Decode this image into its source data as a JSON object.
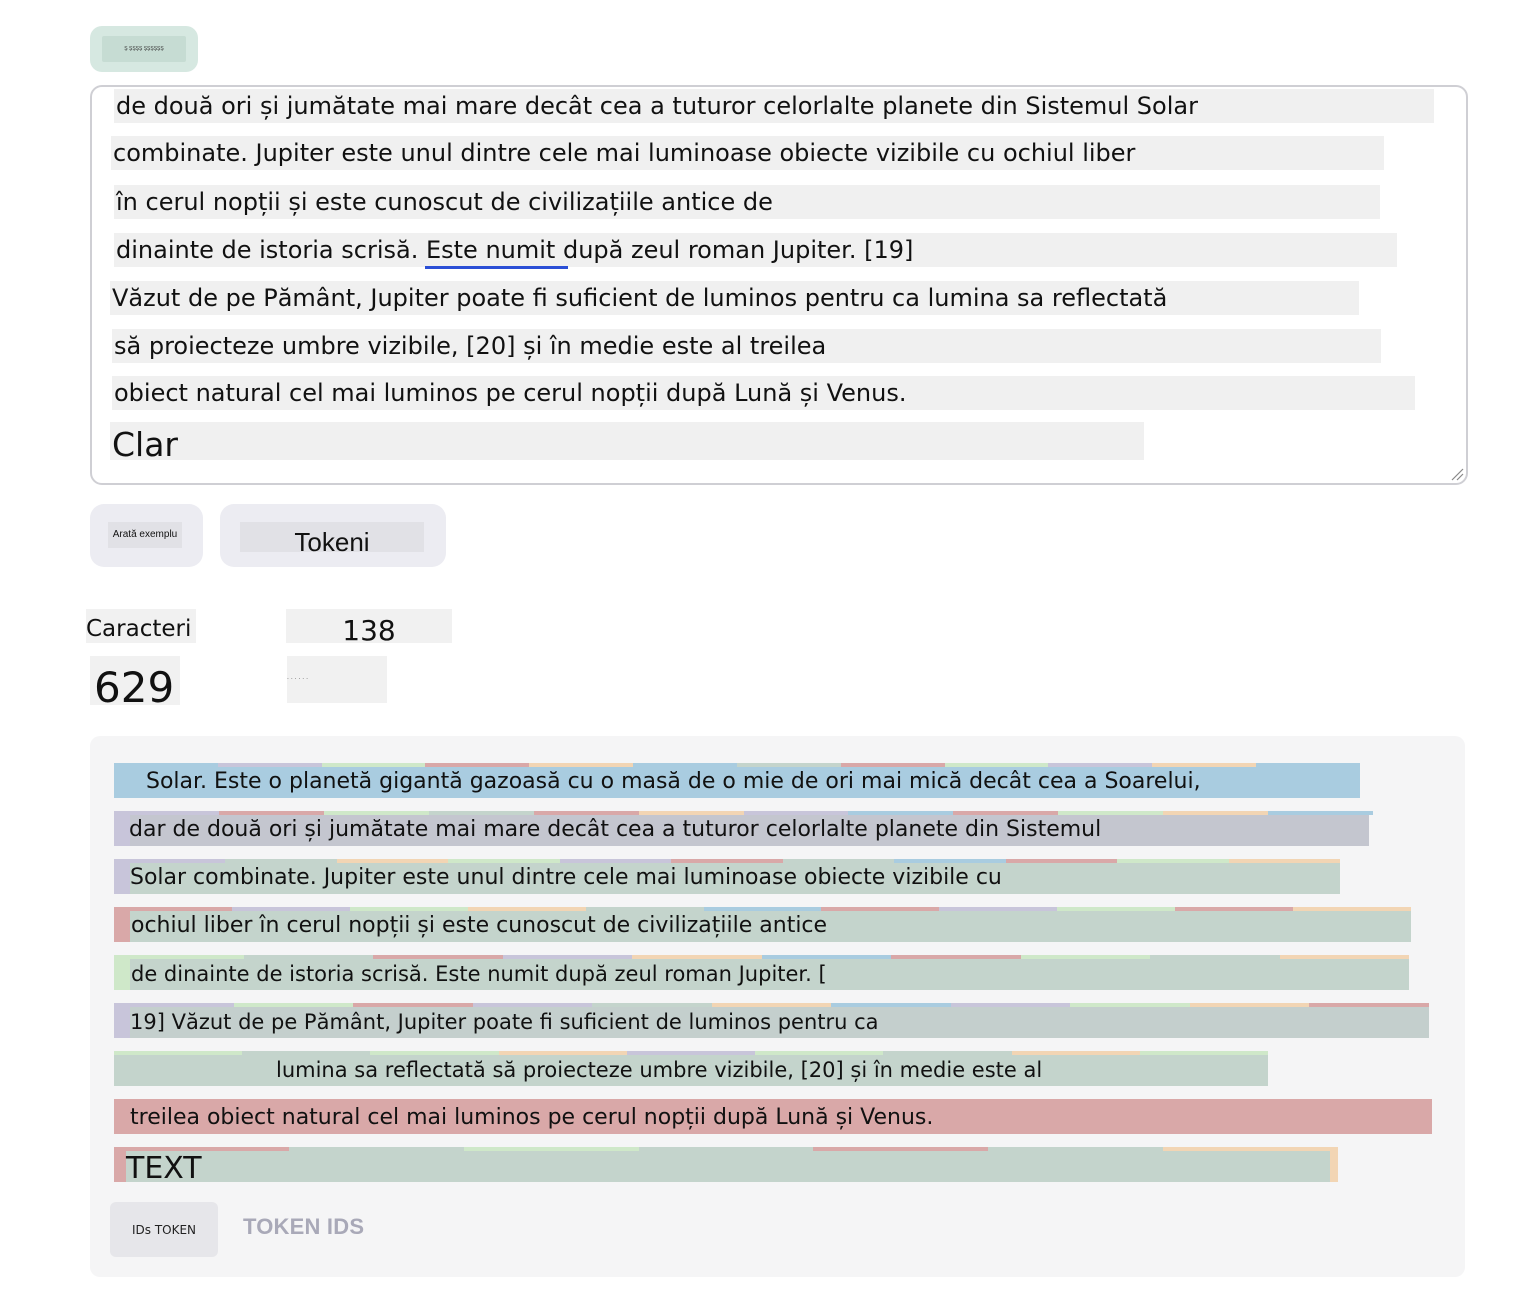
{
  "top_pill": {
    "label": "Ş ŞŞŞŞ ŞŞŞŞŞŞ"
  },
  "textbox": {
    "lines": [
      "de două ori și jumătate mai mare decât cea a tuturor celorlalte planete din Sistemul Solar",
      "combinate. Jupiter este unul dintre cele mai luminoase obiecte vizibile cu ochiul liber",
      "în cerul nopții și este cunoscut de civilizațiile antice de",
      "dinainte de istoria scrisă. Este numit după zeul roman Jupiter. [19]",
      "Văzut de pe Pământ, Jupiter poate fi suficient de luminos pentru ca lumina sa reflectată",
      "să proiecteze umbre vizibile, [20] și în medie este al treilea",
      "obiect natural cel mai luminos pe cerul nopții după Lună și Venus.",
      "Clar"
    ]
  },
  "buttons": {
    "show_example": "Arată exemplu",
    "tokens": "Tokeni"
  },
  "stats": {
    "characters_label": "Caracteri",
    "tokens_count": "138",
    "characters_count": "629",
    "tokens_label": "· · · · · ·"
  },
  "tokens": {
    "rows": [
      "Solar. Este o planetă gigantă gazoasă cu o masă de o mie de ori mai mică decât cea a Soarelui,",
      "dar de două ori și jumătate mai mare decât cea a tuturor celorlalte planete din Sistemul",
      "Solar combinate. Jupiter este unul dintre cele mai luminoase obiecte vizibile cu",
      "ochiul liber în cerul nopții și este cunoscut de civilizațiile antice",
      "de dinainte de istoria scrisă. Este numit după zeul roman Jupiter. [",
      "19] Văzut de pe Pământ, Jupiter poate fi suficient de luminos pentru ca",
      "lumina sa reflectată să proiecteze umbre vizibile, [20] și în medie este al",
      "treilea obiect natural cel mai luminos pe cerul nopții după Lună și Venus.",
      "TEXT"
    ],
    "ids_button": "IDs TOKEN",
    "ids_label": "TOKEN IDS"
  },
  "colors": {
    "token_blue": "#a9cce0",
    "token_purple": "#c8c5da",
    "token_green": "#c4d4cc",
    "token_red": "#d9a8a8",
    "token_orange": "#f2d5b4",
    "token_lime": "#cfe8c9",
    "underline": "#2b4fd6"
  }
}
